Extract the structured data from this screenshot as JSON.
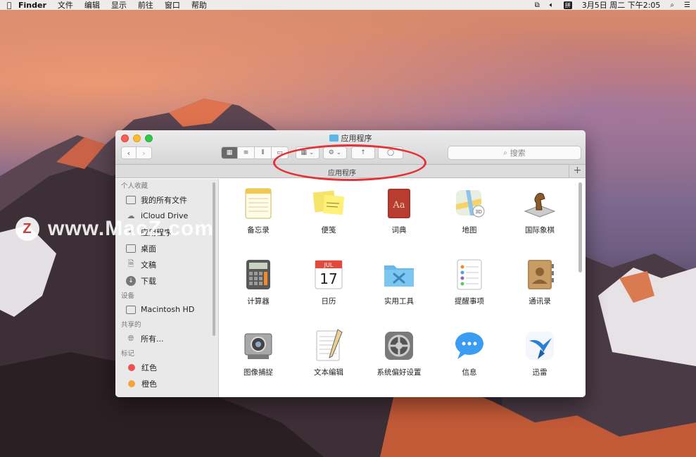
{
  "menubar": {
    "app_name": "Finder",
    "items": [
      "文件",
      "编辑",
      "显示",
      "前往",
      "窗口",
      "帮助"
    ],
    "clock": "3月5日 周二 下午2:05",
    "ime": "拼"
  },
  "watermark": {
    "logo_letter": "Z",
    "text": "www.MacZ.com"
  },
  "window": {
    "title": "应用程序",
    "path_title": "应用程序",
    "search_placeholder": "搜索",
    "add_tab": "+"
  },
  "sidebar": {
    "sections": [
      {
        "header": "个人收藏",
        "items": [
          {
            "label": "我的所有文件",
            "icon": "all-files-icon"
          },
          {
            "label": "iCloud Drive",
            "icon": "cloud-icon"
          },
          {
            "label": "应用程序",
            "icon": "applications-icon"
          },
          {
            "label": "桌面",
            "icon": "desktop-icon"
          },
          {
            "label": "文稿",
            "icon": "documents-icon"
          },
          {
            "label": "下载",
            "icon": "downloads-icon"
          }
        ]
      },
      {
        "header": "设备",
        "items": [
          {
            "label": "Macintosh HD",
            "icon": "disk-icon"
          }
        ]
      },
      {
        "header": "共享的",
        "items": [
          {
            "label": "所有...",
            "icon": "network-icon"
          }
        ]
      },
      {
        "header": "标记",
        "items": [
          {
            "label": "红色",
            "color": "#e9524f"
          },
          {
            "label": "橙色",
            "color": "#f4a43a"
          }
        ]
      }
    ]
  },
  "apps": [
    {
      "label": "备忘录",
      "icon": "notes-icon"
    },
    {
      "label": "便笺",
      "icon": "stickies-icon"
    },
    {
      "label": "词典",
      "icon": "dictionary-icon"
    },
    {
      "label": "地图",
      "icon": "maps-icon"
    },
    {
      "label": "国际象棋",
      "icon": "chess-icon"
    },
    {
      "label": "计算器",
      "icon": "calculator-icon"
    },
    {
      "label": "日历",
      "icon": "calendar-icon",
      "month": "JUL",
      "day": "17"
    },
    {
      "label": "实用工具",
      "icon": "utilities-folder-icon"
    },
    {
      "label": "提醒事项",
      "icon": "reminders-icon"
    },
    {
      "label": "通讯录",
      "icon": "contacts-icon"
    },
    {
      "label": "图像捕捉",
      "icon": "image-capture-icon"
    },
    {
      "label": "文本编辑",
      "icon": "textedit-icon"
    },
    {
      "label": "系统偏好设置",
      "icon": "system-preferences-icon"
    },
    {
      "label": "信息",
      "icon": "messages-icon"
    },
    {
      "label": "迅雷",
      "icon": "thunder-icon"
    }
  ],
  "dictionary_glyph": "Aa",
  "colors": {
    "highlight_ellipse": "#e2323a",
    "folder_blue": "#5fb4ea"
  }
}
